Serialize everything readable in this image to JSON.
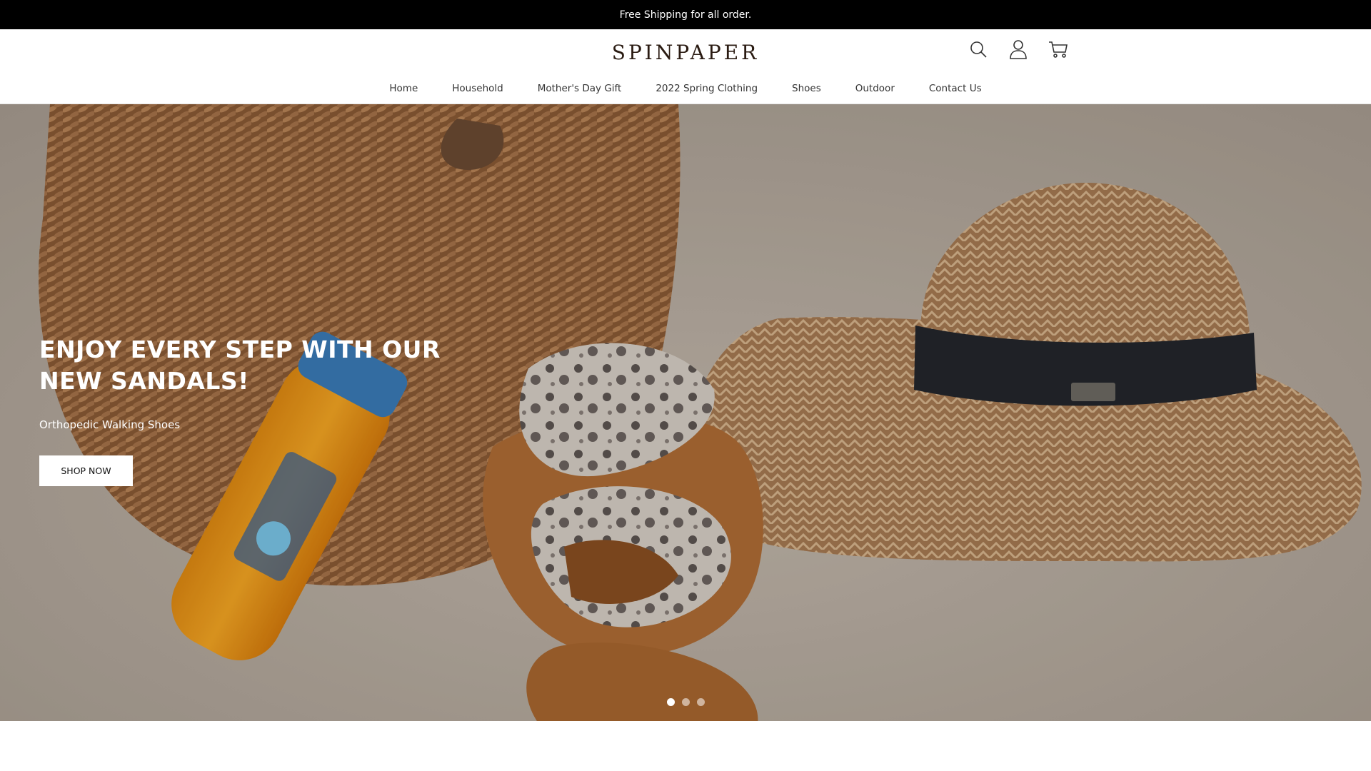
{
  "announcement": "Free Shipping for all order.",
  "brand": "SPINPAPER",
  "icons": [
    "search-icon",
    "account-icon",
    "cart-icon"
  ],
  "nav": [
    "Home",
    "Household",
    "Mother's Day Gift",
    "2022 Spring Clothing",
    "Shoes",
    "Outdoor",
    "Contact Us"
  ],
  "hero": {
    "title": "ENJOY EVERY STEP WITH OUR NEW SANDALS!",
    "subtitle": "Orthopedic Walking Shoes",
    "button": "SHOP NOW",
    "slides": 3,
    "active_slide": 1
  },
  "colors": {
    "announcement_bg": "#000000",
    "brand": "#2a1b12"
  }
}
